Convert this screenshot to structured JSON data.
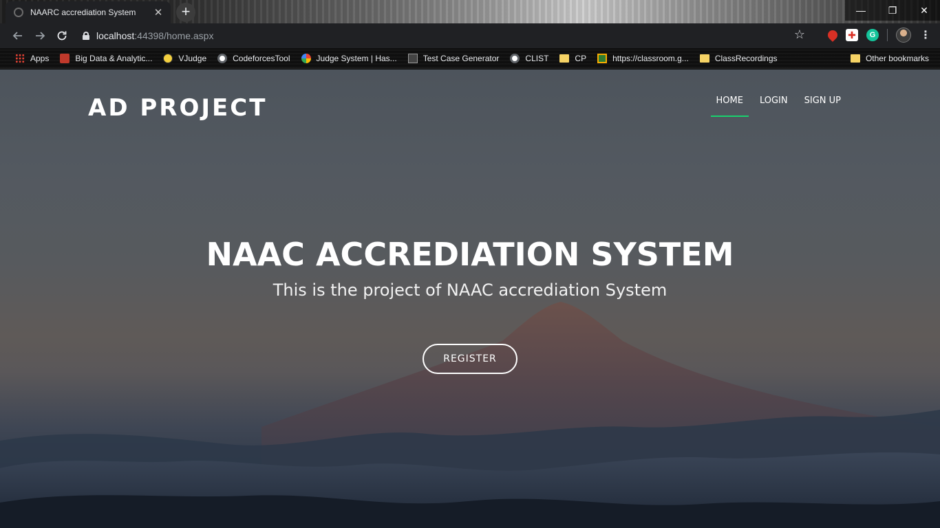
{
  "browser": {
    "tab_title": "NAARC accrediation System",
    "url_host": "localhost",
    "url_rest": ":44398/home.aspx",
    "bookmarks": [
      {
        "label": "Apps",
        "icon": "apps-grid-icon"
      },
      {
        "label": "Big Data & Analytic...",
        "icon": "bigdata-icon"
      },
      {
        "label": "VJudge",
        "icon": "vjudge-icon"
      },
      {
        "label": "CodeforcesTool",
        "icon": "globe-icon"
      },
      {
        "label": "Judge System | Has...",
        "icon": "google-icon"
      },
      {
        "label": "Test Case Generator",
        "icon": "testcase-icon"
      },
      {
        "label": "CLIST",
        "icon": "globe-icon"
      },
      {
        "label": "CP",
        "icon": "folder-icon"
      },
      {
        "label": "https://classroom.g...",
        "icon": "classroom-icon"
      },
      {
        "label": "ClassRecordings",
        "icon": "folder-icon"
      }
    ],
    "other_bookmarks": "Other bookmarks"
  },
  "site": {
    "brand": "AD PROJECT",
    "nav": [
      {
        "label": "HOME",
        "active": true
      },
      {
        "label": "LOGIN",
        "active": false
      },
      {
        "label": "SIGN UP",
        "active": false
      }
    ],
    "hero_title": "NAAC ACCREDIATION SYSTEM",
    "hero_subtitle": "This is the project of NAAC accrediation System",
    "register_label": "REGISTER"
  },
  "colors": {
    "nav_active_underline": "#18d26e",
    "chrome_bg": "#202124"
  }
}
